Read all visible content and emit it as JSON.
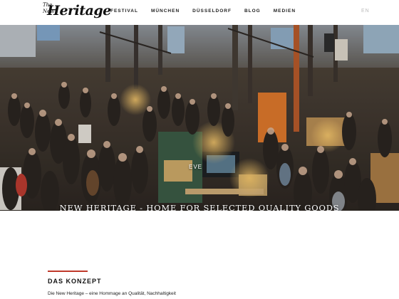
{
  "header": {
    "logo_small_top": "The",
    "logo_small_bottom": "New",
    "logo_main": "Heritage",
    "nav": [
      "FESTIVAL",
      "MÜNCHEN",
      "DÜSSELDORF",
      "BLOG",
      "MEDIEN"
    ],
    "language": "EN"
  },
  "hero": {
    "image_subject": "crowded indoor market hall with vendor stalls",
    "sign_text": "EVE",
    "caption": "NEW HERITAGE - HOME FOR SELECTED QUALITY GOODS"
  },
  "section": {
    "title": "DAS KONZEPT",
    "intro": "Die New Heritage – eine Hommage an Qualität, Nachhaltigkeit",
    "accent_color": "#c0392b"
  }
}
